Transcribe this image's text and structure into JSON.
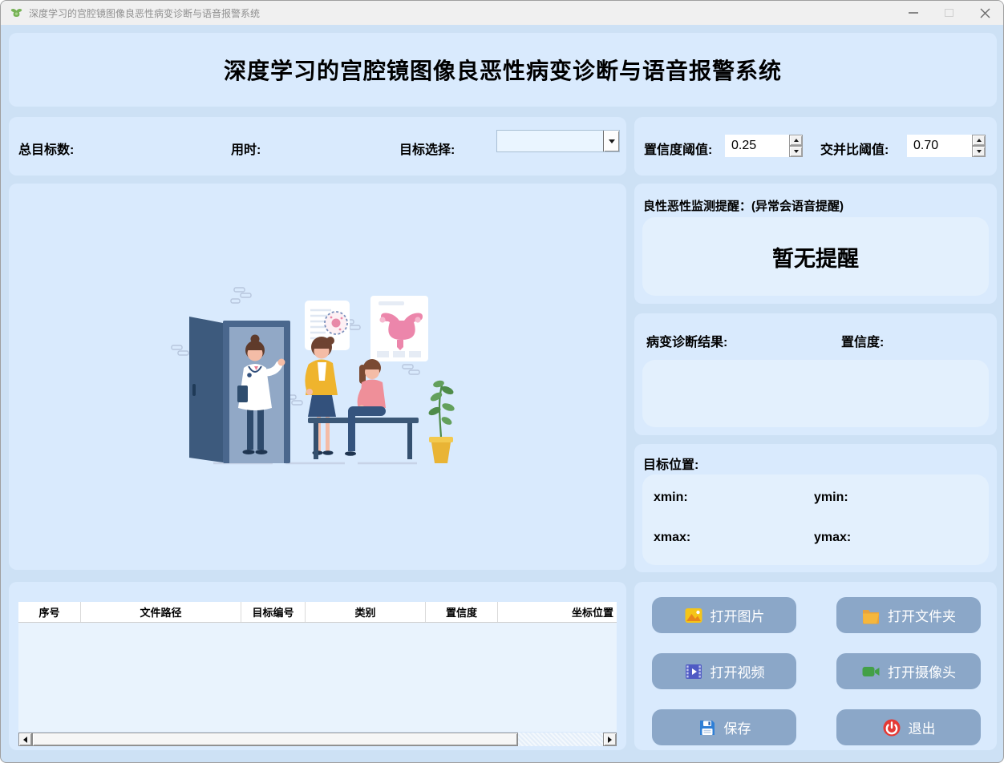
{
  "window": {
    "title": "深度学习的宫腔镜图像良恶性病变诊断与语音报警系统"
  },
  "header": {
    "title": "深度学习的宫腔镜图像良恶性病变诊断与语音报警系统"
  },
  "stats_bar": {
    "total_targets_label": "总目标数:",
    "time_label": "用时:",
    "target_select_label": "目标选择:",
    "target_select_value": ""
  },
  "thresholds": {
    "confidence_label": "置信度阈值:",
    "confidence_value": "0.25",
    "iou_label": "交并比阈值:",
    "iou_value": "0.70"
  },
  "alert_panel": {
    "title": "良性恶性监测提醒：(异常会语音提醒)",
    "message": "暂无提醒"
  },
  "diagnosis_panel": {
    "result_label": "病变诊断结果:",
    "confidence_label": "置信度:",
    "result_value": "",
    "confidence_value": ""
  },
  "position_panel": {
    "title": "目标位置:",
    "xmin_label": "xmin:",
    "ymin_label": "ymin:",
    "xmax_label": "xmax:",
    "ymax_label": "ymax:"
  },
  "buttons": {
    "open_image": "打开图片",
    "open_folder": "打开文件夹",
    "open_video": "打开视频",
    "open_camera": "打开摄像头",
    "save": "保存",
    "exit": "退出"
  },
  "table": {
    "columns": [
      "序号",
      "文件路径",
      "目标编号",
      "类别",
      "置信度",
      "坐标位置"
    ],
    "rows": []
  },
  "icons": {
    "app": "green-uterus-icon",
    "open_image": "image-icon",
    "open_folder": "folder-icon",
    "open_video": "film-play-icon",
    "open_camera": "video-camera-icon",
    "save": "floppy-icon",
    "exit": "power-icon",
    "combo": "chevron-down-icon"
  },
  "colors": {
    "window_bg": "#cde1f5",
    "panel_bg": "#d9eafd",
    "inner_box_bg": "#e3f0fd",
    "button_bg": "#8ba7c8",
    "button_text": "#ffffff",
    "titlebar_bg": "#f0f0f0",
    "table_header_bg": "#ffffff",
    "table_body_bg": "#e9f3fd"
  }
}
